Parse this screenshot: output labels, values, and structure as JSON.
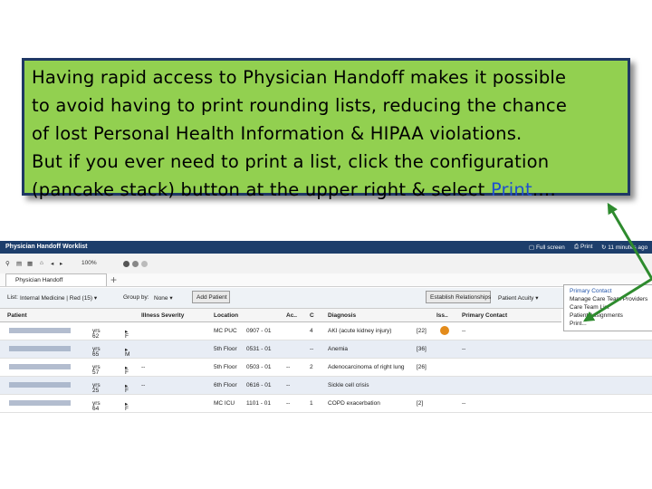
{
  "callout": {
    "line1": "Having rapid access to Physician Handoff makes it possible",
    "line2": "to avoid having to print rounding lists, reducing the chance",
    "line3": "of lost Personal Health Information & HIPAA violations.",
    "line4_prefix": "But if you ever need to print a list, click the configuration",
    "line5_prefix": "(pancake stack) button at the upper right & select ",
    "line5_highlight": "Print",
    "line5_suffix": "…."
  },
  "colors": {
    "callout_bg": "#92d050",
    "callout_border": "#1f3864",
    "arrow": "#2e8b2e",
    "titlebar": "#1d3e6b",
    "highlight": "#1f4fd0"
  },
  "window": {
    "title": "Physician Handoff Worklist",
    "full_screen": "Full screen",
    "print": "Print",
    "updated": "11 minutes ago"
  },
  "toolbar": {
    "zoom": "100%"
  },
  "tab": {
    "label": "Physician Handoff"
  },
  "filters": {
    "list_label": "List:",
    "list_value": "Internal Medicine | Red (15)",
    "group_label": "Group by:",
    "group_value": "None",
    "add_patient": "Add Patient",
    "establish": "Establish Relationships",
    "acuity": "Patient Acuity"
  },
  "columns": [
    "Patient",
    "Illness Severity",
    "Location",
    "Ac..",
    "C",
    "Diagnosis",
    "Iss..",
    "Primary Contact"
  ],
  "rows": [
    {
      "age": "62",
      "sex": "F",
      "location": "MC PUC",
      "bed": "0907 - 01",
      "c": "4",
      "diagnosis": "AKI (acute kidney injury)",
      "iss": "[22]",
      "contact": "--",
      "ac": "",
      "sev": ""
    },
    {
      "age": "65",
      "sex": "M",
      "location": "5th Floor",
      "bed": "0531 - 01",
      "c": "--",
      "diagnosis": "Anemia",
      "iss": "[36]",
      "contact": "--",
      "ac": "",
      "sev": ""
    },
    {
      "age": "57",
      "sex": "F",
      "location": "5th Floor",
      "bed": "0503 - 01",
      "c": "2",
      "diagnosis": "Adenocarcinoma of right lung",
      "iss": "[26]",
      "contact": "",
      "ac": "--",
      "sev": "--"
    },
    {
      "age": "25",
      "sex": "F",
      "location": "6th Floor",
      "bed": "0616 - 01",
      "c": "",
      "diagnosis": "Sickle cell crisis",
      "iss": "",
      "contact": "",
      "ac": "--",
      "sev": "--"
    },
    {
      "age": "64",
      "sex": "F",
      "location": "MC ICU",
      "bed": "1101 - 01",
      "c": "1",
      "diagnosis": "COPD exacerbation",
      "iss": "[2]",
      "contact": "--",
      "ac": "--",
      "sev": ""
    }
  ],
  "menu": {
    "items": [
      "Primary Contact",
      "Manage Care Team Providers",
      "Care Team List",
      "Patient Assignments",
      "Print..."
    ]
  }
}
